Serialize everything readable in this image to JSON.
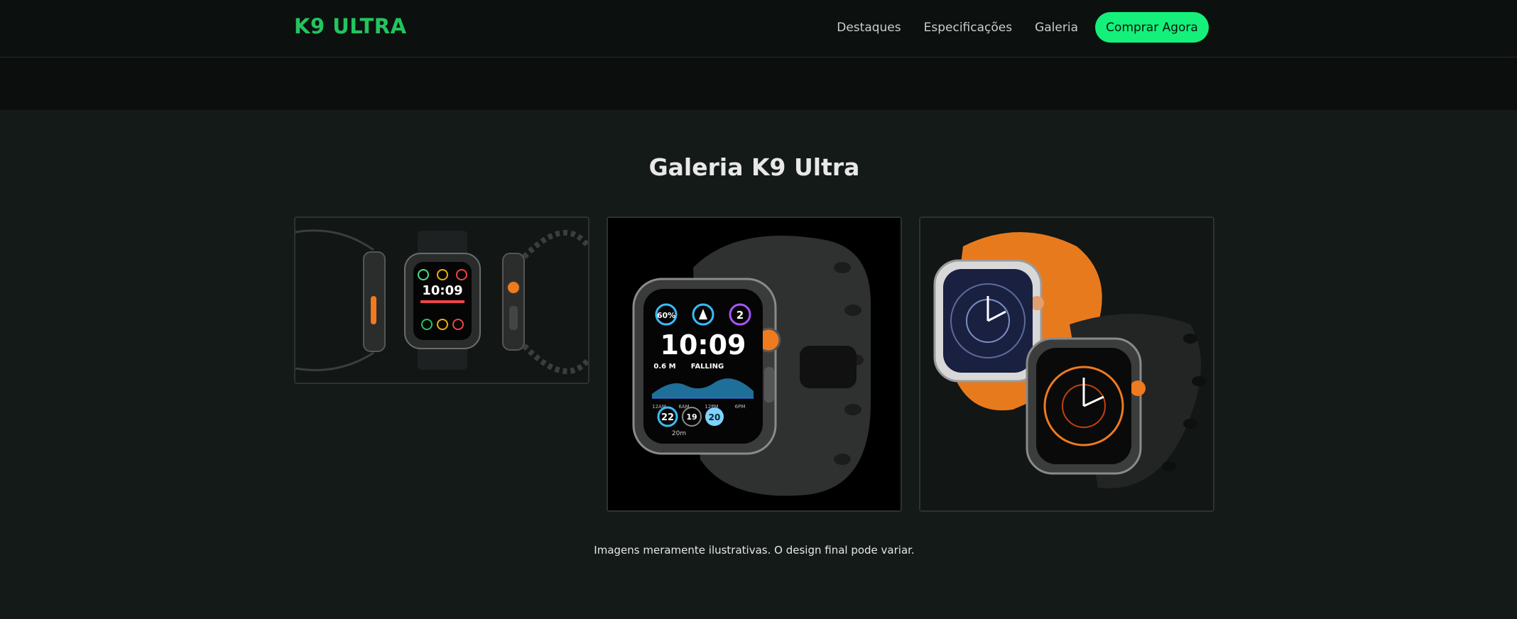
{
  "brand": {
    "logo": "K9 ULTRA"
  },
  "nav": {
    "links": [
      "Destaques",
      "Especificações",
      "Galeria"
    ],
    "cta": "Comprar Agora"
  },
  "gallery": {
    "title": "Galeria K9 Ultra",
    "disclaimer": "Imagens meramente ilustrativas. O design final pode variar.",
    "images": [
      {
        "description": "K9 Ultra front and side views, black band"
      },
      {
        "description": "K9 Ultra close-up, black ocean band"
      },
      {
        "description": "Two K9 Ultra watches, orange and black bands"
      }
    ],
    "watch_face": {
      "time": "10:09",
      "battery": "60%",
      "ring": "2",
      "pressure": "0.6 M",
      "trend": "FALLING",
      "bottom_left": "22",
      "bottom_mid": "19",
      "bottom_right": "20",
      "depth": "20m",
      "axis": [
        "12AM",
        "6AM",
        "12PM",
        "6PM"
      ]
    },
    "small_face_time": "10:09"
  },
  "colors": {
    "accent": "#14f07a",
    "logo": "#22c55e",
    "background": "#141a17",
    "nav": "#0c100e"
  }
}
